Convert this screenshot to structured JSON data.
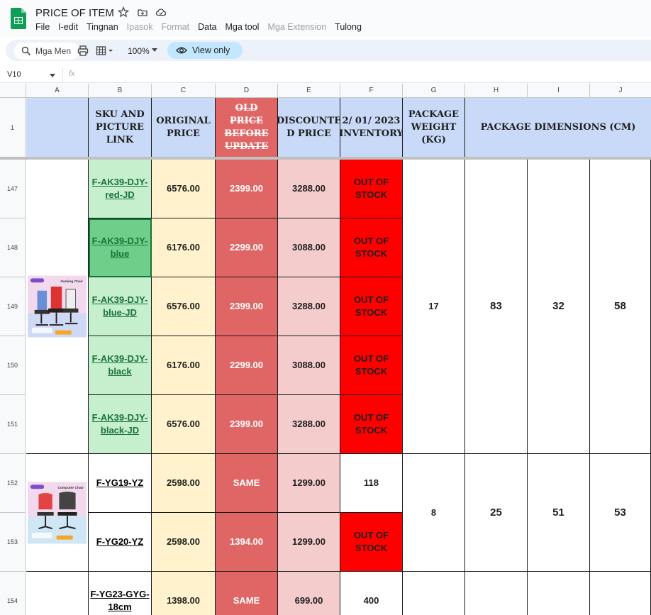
{
  "app": {
    "doc_title": "PRICE OF ITEM",
    "menu": [
      "File",
      "I-edit",
      "Tingnan",
      "Ipasok",
      "Format",
      "Data",
      "Mga tool",
      "Mga Extension",
      "Tulong"
    ],
    "search_placeholder": "Mga Men",
    "zoom": "100%",
    "view_only": "View only",
    "name_box": "V10",
    "fx": "fx"
  },
  "columns": [
    "A",
    "B",
    "C",
    "D",
    "E",
    "F",
    "G",
    "H",
    "I",
    "J"
  ],
  "header_row": {
    "row_num": "1",
    "sku": "SKU AND PICTURE LINK",
    "original": "ORIGINAL PRICE",
    "old": "OLD PRICE BEFORE UPDATE",
    "discounted": "DISCOUNTE D PRICE",
    "inventory": "2/ 01/ 2023 INVENTORY",
    "weight": "PACKAGE WEIGHT (KG)",
    "dims": "PACKAGE DIMENSIONS (CM)"
  },
  "rows": [
    {
      "num": "147",
      "sku": "F-AK39-DJY-red-JD",
      "orig": "6576.00",
      "old": "2399.00",
      "disc": "3288.00",
      "inv": "OUT OF STOCK"
    },
    {
      "num": "148",
      "sku": "F-AK39-DJY-blue",
      "orig": "6176.00",
      "old": "2299.00",
      "disc": "3088.00",
      "inv": "OUT OF STOCK"
    },
    {
      "num": "149",
      "sku": "F-AK39-DJY-blue-JD",
      "orig": "6576.00",
      "old": "2399.00",
      "disc": "3288.00",
      "inv": "OUT OF STOCK"
    },
    {
      "num": "150",
      "sku": "F-AK39-DJY-black",
      "orig": "6176.00",
      "old": "2299.00",
      "disc": "3088.00",
      "inv": "OUT OF STOCK"
    },
    {
      "num": "151",
      "sku": "F-AK39-DJY-black-JD",
      "orig": "6576.00",
      "old": "2399.00",
      "disc": "3288.00",
      "inv": "OUT OF STOCK"
    },
    {
      "num": "152",
      "sku": "F-YG19-YZ",
      "orig": "2598.00",
      "old": "SAME",
      "disc": "1299.00",
      "inv": "118"
    },
    {
      "num": "153",
      "sku": "F-YG20-YZ",
      "orig": "2598.00",
      "old": "1394.00",
      "disc": "1299.00",
      "inv": "OUT OF STOCK"
    },
    {
      "num": "154",
      "sku": "F-YG23-GYG-18cm",
      "orig": "1398.00",
      "old": "SAME",
      "disc": "699.00",
      "inv": "400"
    }
  ],
  "groups": [
    {
      "weight": "17",
      "h": "83",
      "i": "32",
      "j": "58",
      "product_label": "Gaming Chair"
    },
    {
      "weight": "8",
      "h": "25",
      "i": "51",
      "j": "53",
      "product_label": "Computer Chair"
    }
  ],
  "colors": {
    "header_blue": "#c9daf8",
    "sku_green": "#c6efce",
    "original_yellow": "#fff2cc",
    "old_red": "#e06666",
    "discount_pink": "#f4cccc",
    "out_of_stock_red": "#ff0000"
  }
}
